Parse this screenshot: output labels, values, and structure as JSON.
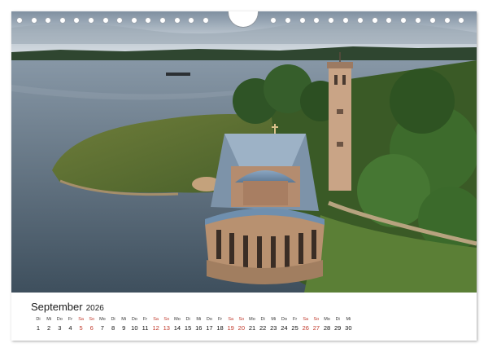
{
  "calendar": {
    "month": "September",
    "year": "2026",
    "days": [
      {
        "dow": "Di",
        "d": "1",
        "we": false
      },
      {
        "dow": "Mi",
        "d": "2",
        "we": false
      },
      {
        "dow": "Do",
        "d": "3",
        "we": false
      },
      {
        "dow": "Fr",
        "d": "4",
        "we": false
      },
      {
        "dow": "Sa",
        "d": "5",
        "we": true
      },
      {
        "dow": "So",
        "d": "6",
        "we": true
      },
      {
        "dow": "Mo",
        "d": "7",
        "we": false
      },
      {
        "dow": "Di",
        "d": "8",
        "we": false
      },
      {
        "dow": "Mi",
        "d": "9",
        "we": false
      },
      {
        "dow": "Do",
        "d": "10",
        "we": false
      },
      {
        "dow": "Fr",
        "d": "11",
        "we": false
      },
      {
        "dow": "Sa",
        "d": "12",
        "we": true
      },
      {
        "dow": "So",
        "d": "13",
        "we": true
      },
      {
        "dow": "Mo",
        "d": "14",
        "we": false
      },
      {
        "dow": "Di",
        "d": "15",
        "we": false
      },
      {
        "dow": "Mi",
        "d": "16",
        "we": false
      },
      {
        "dow": "Do",
        "d": "17",
        "we": false
      },
      {
        "dow": "Fr",
        "d": "18",
        "we": false
      },
      {
        "dow": "Sa",
        "d": "19",
        "we": true
      },
      {
        "dow": "So",
        "d": "20",
        "we": true
      },
      {
        "dow": "Mo",
        "d": "21",
        "we": false
      },
      {
        "dow": "Di",
        "d": "22",
        "we": false
      },
      {
        "dow": "Mi",
        "d": "23",
        "we": false
      },
      {
        "dow": "Do",
        "d": "24",
        "we": false
      },
      {
        "dow": "Fr",
        "d": "25",
        "we": false
      },
      {
        "dow": "Sa",
        "d": "26",
        "we": true
      },
      {
        "dow": "So",
        "d": "27",
        "we": true
      },
      {
        "dow": "Mo",
        "d": "28",
        "we": false
      },
      {
        "dow": "Di",
        "d": "29",
        "we": false
      },
      {
        "dow": "Mi",
        "d": "30",
        "we": false
      }
    ]
  },
  "colors": {
    "weekend": "#c0392b",
    "water": "#5b6f80",
    "foliage": "#3f6a2e",
    "roof": "#6f8fae",
    "brick": "#c9a486"
  }
}
